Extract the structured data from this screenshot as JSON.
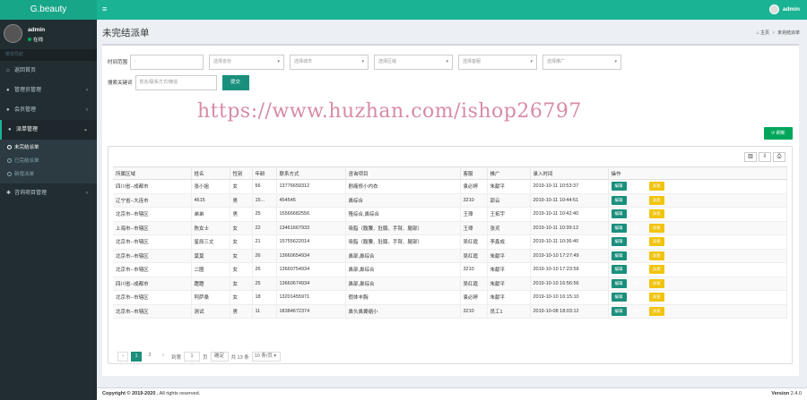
{
  "app": {
    "logo": "G.beauty",
    "menu_icon": "≡",
    "top_user": "admin"
  },
  "sidebar": {
    "user_name": "admin",
    "user_status": "在线",
    "section_header": "菜单导航",
    "items": [
      {
        "label": "返回首页",
        "icon": "home-icon",
        "glyph": "⌂",
        "has_children": false
      },
      {
        "label": "管理员管理",
        "icon": "user-icon",
        "glyph": "●",
        "has_children": true
      },
      {
        "label": "会员管理",
        "icon": "user-icon",
        "glyph": "●",
        "has_children": true
      },
      {
        "label": "派单管理",
        "icon": "user-icon",
        "glyph": "●",
        "has_children": true,
        "active": true
      },
      {
        "label": "咨询项目管理",
        "icon": "gear-icon",
        "glyph": "✱",
        "has_children": true
      }
    ],
    "sub_items": [
      {
        "label": "未完结派单",
        "active": true
      },
      {
        "label": "已完结派单"
      },
      {
        "label": "新增派单"
      }
    ],
    "chevron": "‹"
  },
  "page": {
    "title": "未完结派单",
    "breadcrumb_home": "主页",
    "breadcrumb_current": "未完结派单"
  },
  "filters": {
    "time_label": "时间范围",
    "time_value": "-",
    "select_province": "选择省份",
    "select_city": "选择城市",
    "select_district": "选择区域",
    "select_service": "选择客服",
    "select_promo": "选择推广",
    "keyword_label": "搜索关键词",
    "keyword_placeholder": "姓名/联系方式/微信",
    "submit_label": "提交",
    "caret": "▾"
  },
  "watermark": "https://www.huzhan.com/ishop26797",
  "toolbar": {
    "refresh_label": "⟳ 刷新",
    "tool_1": "▥",
    "tool_2": "⇩",
    "tool_3": "⎙"
  },
  "table": {
    "headers": [
      "所属区域",
      "姓名",
      "性别",
      "年龄",
      "联系方式",
      "咨询项目",
      "客服",
      "推广",
      "录入时间",
      "操作"
    ],
    "rows": [
      [
        "四川省--成都市",
        "张小姐",
        "女",
        "56",
        "13776659312",
        "剧痛修小内衣",
        "袁必婷",
        "朱献平",
        "2019-10-11 10:53:37"
      ],
      [
        "辽宁省--大连市",
        "4615",
        "男",
        "15...",
        "454545",
        "鼻综合",
        "3210",
        "郭云",
        "2019-10-11 10:44:51"
      ],
      [
        "北京市--市辖区",
        "弟弟",
        "男",
        "25",
        "15566682556",
        "隆综合,鼻综合",
        "王璋",
        "王拓宇",
        "2019-10-11 10:42:40"
      ],
      [
        "上海市--市辖区",
        "陈女士",
        "女",
        "22",
        "13461667933",
        "吸脂（腹腰、肚腩、手臂、腿部）",
        "王璋",
        "张灵",
        "2019-10-11 10:39:12"
      ],
      [
        "北京市--市辖区",
        "星辰三丈",
        "女",
        "21",
        "15755622014",
        "吸脂（腹腰、肚腩、手臂、腿部）",
        "吴红霞",
        "李鑫成",
        "2019-10-11 10:36:40"
      ],
      [
        "北京市--市辖区",
        "莫莫",
        "女",
        "26",
        "13660654934",
        "鼻部,鼻综合",
        "吴红霞",
        "朱献平",
        "2019-10-10 17:27:49"
      ],
      [
        "北京市--市辖区",
        "二圈",
        "女",
        "26",
        "13660754934",
        "鼻部,鼻综合",
        "3210",
        "朱献平",
        "2019-10-10 17:23:59"
      ],
      [
        "四川省--成都市",
        "蹬蹬",
        "女",
        "25",
        "13660674934",
        "鼻部,鼻综合",
        "吴红霞",
        "朱献平",
        "2019-10-10 16:56:56"
      ],
      [
        "北京市--市辖区",
        "阿萨桑",
        "女",
        "18",
        "13201455971",
        "假体丰胸",
        "袁必婷",
        "朱献平",
        "2019-10-10 16:15:10"
      ],
      [
        "北京市--市辖区",
        "测试",
        "男",
        "11",
        "18384672374",
        "鼻头鼻翼缩小",
        "3210",
        "员工1",
        "2019-10-08 18:03:12"
      ]
    ],
    "actions": {
      "edit": "编辑",
      "delete": "删除",
      "dispatch": "派发"
    }
  },
  "pager": {
    "prev": "‹",
    "page1": "1",
    "page2": "2",
    "next": "›",
    "goto_label": "到第",
    "goto_value": "1",
    "page_unit": "页",
    "confirm": "确定",
    "total": "共 13 条",
    "per_page": "10 条/页 ▾"
  },
  "footer": {
    "copyright_strong": "Copyright © 2019-2020 .",
    "copyright_rest": " All rights reserved.",
    "version": "Version 2.4.0"
  }
}
